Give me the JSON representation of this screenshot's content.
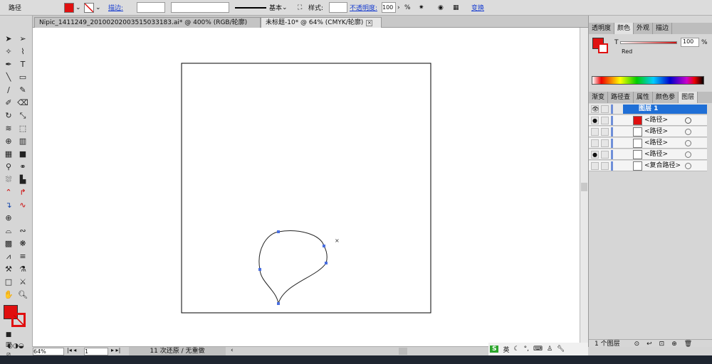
{
  "control_bar": {
    "object_type": "路径",
    "stroke_label": "描边:",
    "stroke_profile": "基本",
    "style_label": "样式:",
    "opacity_label": "不透明度:",
    "opacity_value": "100",
    "opacity_unit": "%",
    "transform_link": "变换",
    "fill_color": "#e01010"
  },
  "doc_tabs": [
    {
      "label": "Nipic_1411249_20100202003515033183.ai* @ 400% (RGB/轮廓)",
      "active": false
    },
    {
      "label": "未标题-10* @ 64% (CMYK/轮廓)",
      "active": true
    }
  ],
  "color_panel": {
    "tabs": [
      "透明度",
      "颜色",
      "外观",
      "描边"
    ],
    "active_tab": "颜色",
    "channel": "T",
    "value": "100",
    "unit": "%",
    "color_name": "Red",
    "color": "#e01010"
  },
  "layers_panel": {
    "tabs": [
      "渐变",
      "路径查",
      "属性",
      "颜色参",
      "图层"
    ],
    "active_tab": "图层",
    "layer": "图层 1",
    "items": [
      {
        "name": "<路径>",
        "visible": true
      },
      {
        "name": "<路径>",
        "visible": false
      },
      {
        "name": "<路径>",
        "visible": false
      },
      {
        "name": "<路径>",
        "visible": true
      },
      {
        "name": "<复合路径>",
        "visible": false
      }
    ],
    "footer": "1 个图层"
  },
  "status_bar": {
    "zoom": "64%",
    "page": "1",
    "message": "11 次还原 / 无重做"
  },
  "ime": {
    "lang": "英"
  }
}
